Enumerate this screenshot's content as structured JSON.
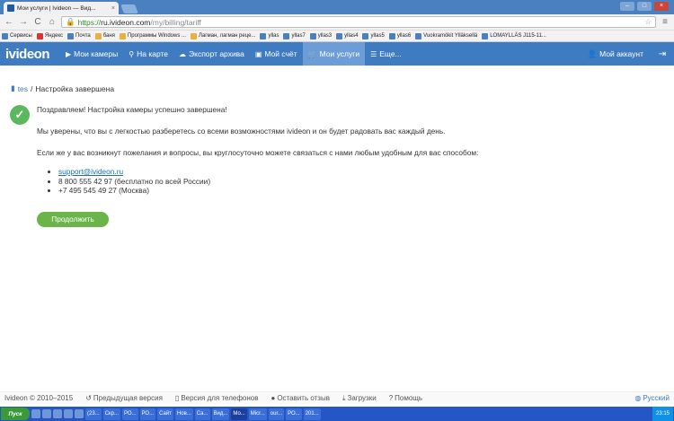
{
  "browser": {
    "tab_title": "Мои услуги | Ivideon — Вид...",
    "tab_close": "×",
    "window_controls": [
      "–",
      "□",
      "×"
    ],
    "nav_back": "←",
    "nav_forward": "→",
    "nav_reload": "C",
    "nav_home": "⌂",
    "url_https": "https://",
    "url_host": "ru.ivideon.com",
    "url_path": "/my/billing/tariff",
    "menu": "≡",
    "bookmarks": [
      "Сервисы",
      "Яндекс",
      "Почта",
      "баня",
      "Программы Windows ...",
      "Лагман, лагман реце...",
      "yllas",
      "yllas7",
      "yllas3",
      "yllas4",
      "yllas5",
      "yllas6",
      "Vuokramökit Ylläksellä",
      "LOMAYLLÄS J115-11..."
    ]
  },
  "header": {
    "logo": "ivideon",
    "nav": [
      {
        "label": "Мои камеры",
        "icon": "▶"
      },
      {
        "label": "На карте",
        "icon": "⚲"
      },
      {
        "label": "Экспорт архива",
        "icon": "☁"
      },
      {
        "label": "Мой счёт",
        "icon": "▣"
      },
      {
        "label": "Мои услуги",
        "icon": "🛒"
      },
      {
        "label": "Еще...",
        "icon": "☰"
      }
    ],
    "account": "Мой аккаунт",
    "logout_icon": "⇥"
  },
  "breadcrumb": {
    "camera": "tes",
    "separator": "/",
    "current": "Настройка завершена"
  },
  "main": {
    "check": "✓",
    "line1": "Поздравляем! Настройка камеры успешно завершена!",
    "line2": "Мы уверены, что вы с легкостью разберетесь со всеми возможностями ivideon и он будет радовать вас каждый день.",
    "line3": "Если же у вас возникнут пожелания и вопросы, вы круглосуточно можете связаться с нами любым удобным для вас способом:",
    "contacts": [
      "support@ivideon.ru",
      "8 800 555 42 97 (бесплатно по всей России)",
      "+7 495 545 49 27 (Москва)"
    ],
    "button": "Продолжить"
  },
  "footer": {
    "copyright": "Ivideon © 2010–2015",
    "links": [
      "Предыдущая версия",
      "Версия для телефонов",
      "Оставить отзыв",
      "Загрузки",
      "Помощь"
    ],
    "language": "Русский"
  },
  "taskbar": {
    "start": "Пуск",
    "items": [
      "(23...",
      "Скр...",
      "РО...",
      "РО...",
      "Сайт",
      "Нов...",
      "Са...",
      "Вид...",
      "Мо...",
      "Micr...",
      "our...",
      "РО...",
      "201..."
    ],
    "clock": "23:15"
  }
}
